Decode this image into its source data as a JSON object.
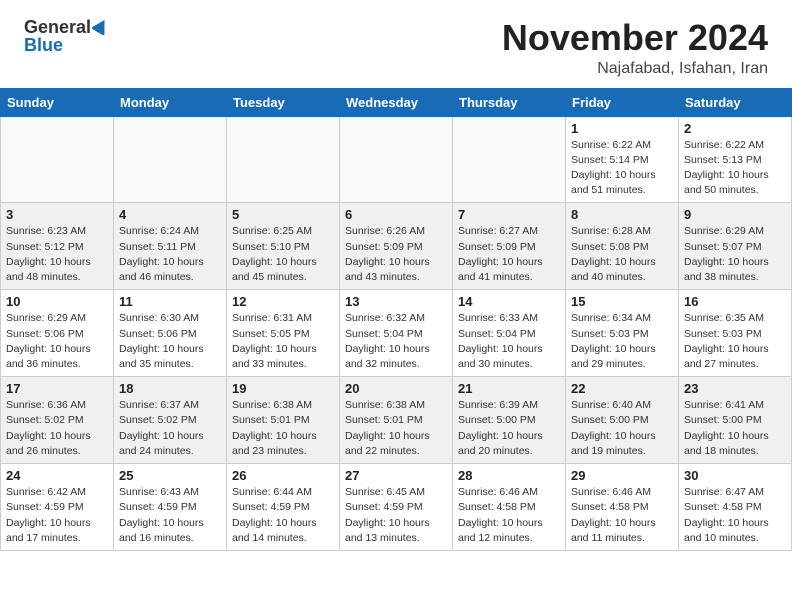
{
  "header": {
    "logo_general": "General",
    "logo_blue": "Blue",
    "month": "November 2024",
    "location": "Najafabad, Isfahan, Iran"
  },
  "weekdays": [
    "Sunday",
    "Monday",
    "Tuesday",
    "Wednesday",
    "Thursday",
    "Friday",
    "Saturday"
  ],
  "weeks": [
    [
      {
        "day": "",
        "info": ""
      },
      {
        "day": "",
        "info": ""
      },
      {
        "day": "",
        "info": ""
      },
      {
        "day": "",
        "info": ""
      },
      {
        "day": "",
        "info": ""
      },
      {
        "day": "1",
        "info": "Sunrise: 6:22 AM\nSunset: 5:14 PM\nDaylight: 10 hours\nand 51 minutes."
      },
      {
        "day": "2",
        "info": "Sunrise: 6:22 AM\nSunset: 5:13 PM\nDaylight: 10 hours\nand 50 minutes."
      }
    ],
    [
      {
        "day": "3",
        "info": "Sunrise: 6:23 AM\nSunset: 5:12 PM\nDaylight: 10 hours\nand 48 minutes."
      },
      {
        "day": "4",
        "info": "Sunrise: 6:24 AM\nSunset: 5:11 PM\nDaylight: 10 hours\nand 46 minutes."
      },
      {
        "day": "5",
        "info": "Sunrise: 6:25 AM\nSunset: 5:10 PM\nDaylight: 10 hours\nand 45 minutes."
      },
      {
        "day": "6",
        "info": "Sunrise: 6:26 AM\nSunset: 5:09 PM\nDaylight: 10 hours\nand 43 minutes."
      },
      {
        "day": "7",
        "info": "Sunrise: 6:27 AM\nSunset: 5:09 PM\nDaylight: 10 hours\nand 41 minutes."
      },
      {
        "day": "8",
        "info": "Sunrise: 6:28 AM\nSunset: 5:08 PM\nDaylight: 10 hours\nand 40 minutes."
      },
      {
        "day": "9",
        "info": "Sunrise: 6:29 AM\nSunset: 5:07 PM\nDaylight: 10 hours\nand 38 minutes."
      }
    ],
    [
      {
        "day": "10",
        "info": "Sunrise: 6:29 AM\nSunset: 5:06 PM\nDaylight: 10 hours\nand 36 minutes."
      },
      {
        "day": "11",
        "info": "Sunrise: 6:30 AM\nSunset: 5:06 PM\nDaylight: 10 hours\nand 35 minutes."
      },
      {
        "day": "12",
        "info": "Sunrise: 6:31 AM\nSunset: 5:05 PM\nDaylight: 10 hours\nand 33 minutes."
      },
      {
        "day": "13",
        "info": "Sunrise: 6:32 AM\nSunset: 5:04 PM\nDaylight: 10 hours\nand 32 minutes."
      },
      {
        "day": "14",
        "info": "Sunrise: 6:33 AM\nSunset: 5:04 PM\nDaylight: 10 hours\nand 30 minutes."
      },
      {
        "day": "15",
        "info": "Sunrise: 6:34 AM\nSunset: 5:03 PM\nDaylight: 10 hours\nand 29 minutes."
      },
      {
        "day": "16",
        "info": "Sunrise: 6:35 AM\nSunset: 5:03 PM\nDaylight: 10 hours\nand 27 minutes."
      }
    ],
    [
      {
        "day": "17",
        "info": "Sunrise: 6:36 AM\nSunset: 5:02 PM\nDaylight: 10 hours\nand 26 minutes."
      },
      {
        "day": "18",
        "info": "Sunrise: 6:37 AM\nSunset: 5:02 PM\nDaylight: 10 hours\nand 24 minutes."
      },
      {
        "day": "19",
        "info": "Sunrise: 6:38 AM\nSunset: 5:01 PM\nDaylight: 10 hours\nand 23 minutes."
      },
      {
        "day": "20",
        "info": "Sunrise: 6:38 AM\nSunset: 5:01 PM\nDaylight: 10 hours\nand 22 minutes."
      },
      {
        "day": "21",
        "info": "Sunrise: 6:39 AM\nSunset: 5:00 PM\nDaylight: 10 hours\nand 20 minutes."
      },
      {
        "day": "22",
        "info": "Sunrise: 6:40 AM\nSunset: 5:00 PM\nDaylight: 10 hours\nand 19 minutes."
      },
      {
        "day": "23",
        "info": "Sunrise: 6:41 AM\nSunset: 5:00 PM\nDaylight: 10 hours\nand 18 minutes."
      }
    ],
    [
      {
        "day": "24",
        "info": "Sunrise: 6:42 AM\nSunset: 4:59 PM\nDaylight: 10 hours\nand 17 minutes."
      },
      {
        "day": "25",
        "info": "Sunrise: 6:43 AM\nSunset: 4:59 PM\nDaylight: 10 hours\nand 16 minutes."
      },
      {
        "day": "26",
        "info": "Sunrise: 6:44 AM\nSunset: 4:59 PM\nDaylight: 10 hours\nand 14 minutes."
      },
      {
        "day": "27",
        "info": "Sunrise: 6:45 AM\nSunset: 4:59 PM\nDaylight: 10 hours\nand 13 minutes."
      },
      {
        "day": "28",
        "info": "Sunrise: 6:46 AM\nSunset: 4:58 PM\nDaylight: 10 hours\nand 12 minutes."
      },
      {
        "day": "29",
        "info": "Sunrise: 6:46 AM\nSunset: 4:58 PM\nDaylight: 10 hours\nand 11 minutes."
      },
      {
        "day": "30",
        "info": "Sunrise: 6:47 AM\nSunset: 4:58 PM\nDaylight: 10 hours\nand 10 minutes."
      }
    ]
  ]
}
